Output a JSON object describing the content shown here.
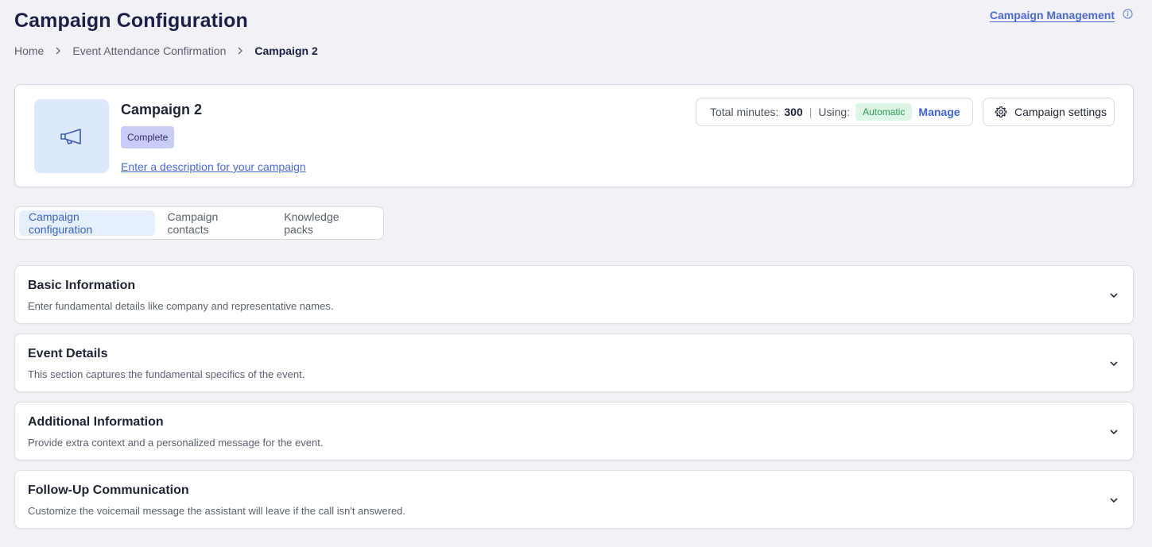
{
  "page": {
    "title": "Campaign Configuration"
  },
  "top_link": {
    "label": "Campaign Management"
  },
  "breadcrumb": {
    "items": [
      "Home",
      "Event Attendance Confirmation"
    ],
    "current": "Campaign 2"
  },
  "campaign": {
    "name": "Campaign 2",
    "status": "Complete",
    "description_link": "Enter a description for your campaign",
    "icon": "megaphone-icon"
  },
  "minutes": {
    "label": "Total minutes:",
    "value": "300",
    "separator": "|",
    "using_label": "Using:",
    "mode": "Automatic",
    "manage_label": "Manage"
  },
  "settings_button": {
    "label": "Campaign settings",
    "icon": "gear-icon"
  },
  "tabs": [
    {
      "label": "Campaign configuration",
      "active": true
    },
    {
      "label": "Campaign contacts",
      "active": false
    },
    {
      "label": "Knowledge packs",
      "active": false
    }
  ],
  "sections": [
    {
      "title": "Basic Information",
      "description": "Enter fundamental details like company and representative names."
    },
    {
      "title": "Event Details",
      "description": "This section captures the fundamental specifics of the event."
    },
    {
      "title": "Additional Information",
      "description": "Provide extra context and a personalized message for the event."
    },
    {
      "title": "Follow-Up Communication",
      "description": "Customize the voicemail message the assistant will leave if the call isn't answered."
    }
  ],
  "colors": {
    "accent": "#4a6ad8",
    "badge_complete_bg": "#c9cdf6",
    "badge_auto_bg": "#def6e6",
    "badge_auto_text": "#2c9a57",
    "thumb_bg": "#dce8fb"
  }
}
